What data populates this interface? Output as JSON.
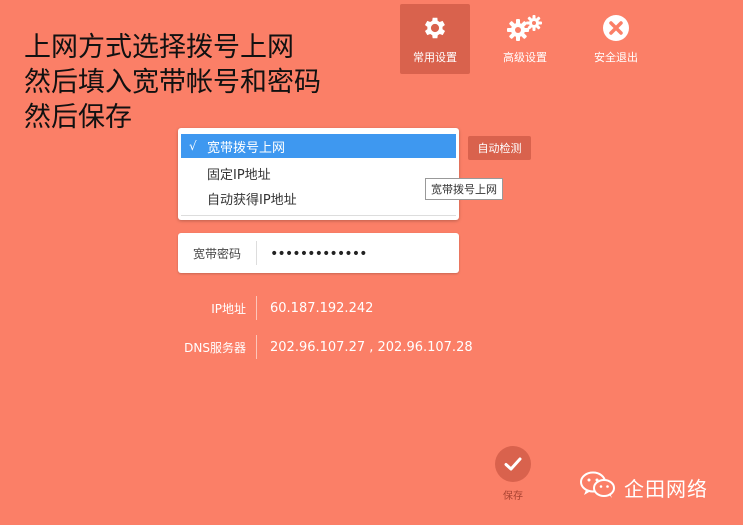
{
  "annotation": {
    "lines": [
      "上网方式选择拨号上网",
      "然后填入宽带帐号和密码",
      "然后保存"
    ]
  },
  "nav": {
    "items": [
      {
        "label": "常用设置",
        "icon": "gear-icon",
        "active": true
      },
      {
        "label": "高级设置",
        "icon": "gears-icon",
        "active": false
      },
      {
        "label": "安全退出",
        "icon": "close-circle-icon",
        "active": false
      }
    ]
  },
  "connection_dropdown": {
    "options": [
      {
        "label": "宽带拨号上网",
        "selected": true
      },
      {
        "label": "固定IP地址",
        "selected": false
      },
      {
        "label": "自动获得IP地址",
        "selected": false
      }
    ],
    "check_mark": "√",
    "tooltip": "宽带拨号上网"
  },
  "auto_detect_button": {
    "label": "自动检测"
  },
  "password": {
    "label": "宽带密码",
    "value": "•••••••••••••"
  },
  "info": {
    "ip": {
      "label": "IP地址",
      "value": "60.187.192.242"
    },
    "dns": {
      "label": "DNS服务器",
      "value": "202.96.107.27 , 202.96.107.28"
    }
  },
  "save_button": {
    "label": "保存",
    "icon": "checkmark-icon"
  },
  "watermark": {
    "text": "企田网络",
    "icon": "wechat-icon"
  },
  "colors": {
    "background": "#fb7f67",
    "accent": "#d9624d",
    "selection": "#3e98f0"
  }
}
